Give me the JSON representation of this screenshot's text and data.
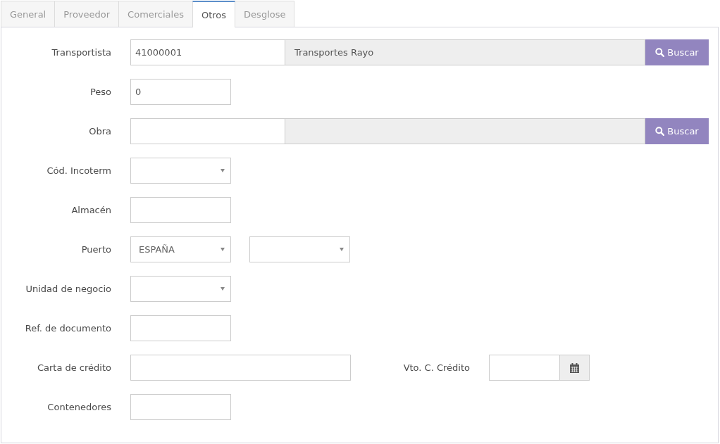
{
  "tabs": [
    {
      "label": "General",
      "selected": false
    },
    {
      "label": "Proveedor",
      "selected": false
    },
    {
      "label": "Comerciales",
      "selected": false
    },
    {
      "label": "Otros",
      "selected": true
    },
    {
      "label": "Desglose",
      "selected": false
    }
  ],
  "form": {
    "rows": [
      {
        "label": "Transportista",
        "fields": [
          {
            "kind": "lookup",
            "value": "41000001",
            "description": "Transportes Rayo",
            "button": "Buscar"
          }
        ]
      },
      {
        "label": "Peso",
        "fields": [
          {
            "kind": "text",
            "value": "0"
          }
        ]
      },
      {
        "label": "Obra",
        "fields": [
          {
            "kind": "lookup",
            "button": "Buscar"
          }
        ]
      },
      {
        "label": "Cód. Incoterm",
        "fields": [
          {
            "kind": "select"
          }
        ]
      },
      {
        "label": "Almacén",
        "fields": [
          {
            "kind": "text"
          }
        ]
      },
      {
        "label": "Puerto",
        "fields": [
          {
            "kind": "select",
            "value": "ESPAÑA"
          },
          {
            "kind": "select"
          }
        ]
      },
      {
        "label": "Unidad de negocio",
        "fields": [
          {
            "kind": "select"
          }
        ]
      },
      {
        "label": "Ref. de documento",
        "fields": [
          {
            "kind": "text"
          }
        ]
      },
      {
        "label": "Carta de crédito",
        "fields": [
          {
            "kind": "text"
          },
          {
            "kind": "date",
            "label": "Vto. C. Crédito"
          }
        ]
      },
      {
        "label": "Contenedores",
        "fields": [
          {
            "kind": "text"
          }
        ]
      }
    ]
  }
}
